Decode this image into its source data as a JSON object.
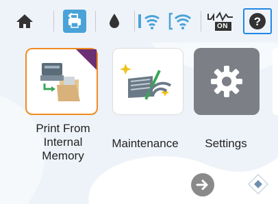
{
  "statusbar": {
    "home_icon": "home-icon",
    "printer_settings_icon": "printer-settings-icon",
    "ink_icon": "ink-drop-icon",
    "wifi_direct_icon": "wifi-direct-icon",
    "wifi_icon": "wifi-icon",
    "eco_mode_text": "ON",
    "help_icon": "help-icon",
    "accent_color": "#4aa3d8",
    "help_border_color": "#1e88e5"
  },
  "apps": [
    {
      "label": "Print From\nInternal\nMemory",
      "icon": "print-from-memory-icon",
      "selected": true
    },
    {
      "label": "Maintenance",
      "icon": "maintenance-icon",
      "selected": false
    },
    {
      "label": "Settings",
      "icon": "gear-icon",
      "selected": false
    }
  ],
  "nav": {
    "next_icon": "arrow-right-icon",
    "page_indicator_icon": "diamond-nav-icon"
  }
}
